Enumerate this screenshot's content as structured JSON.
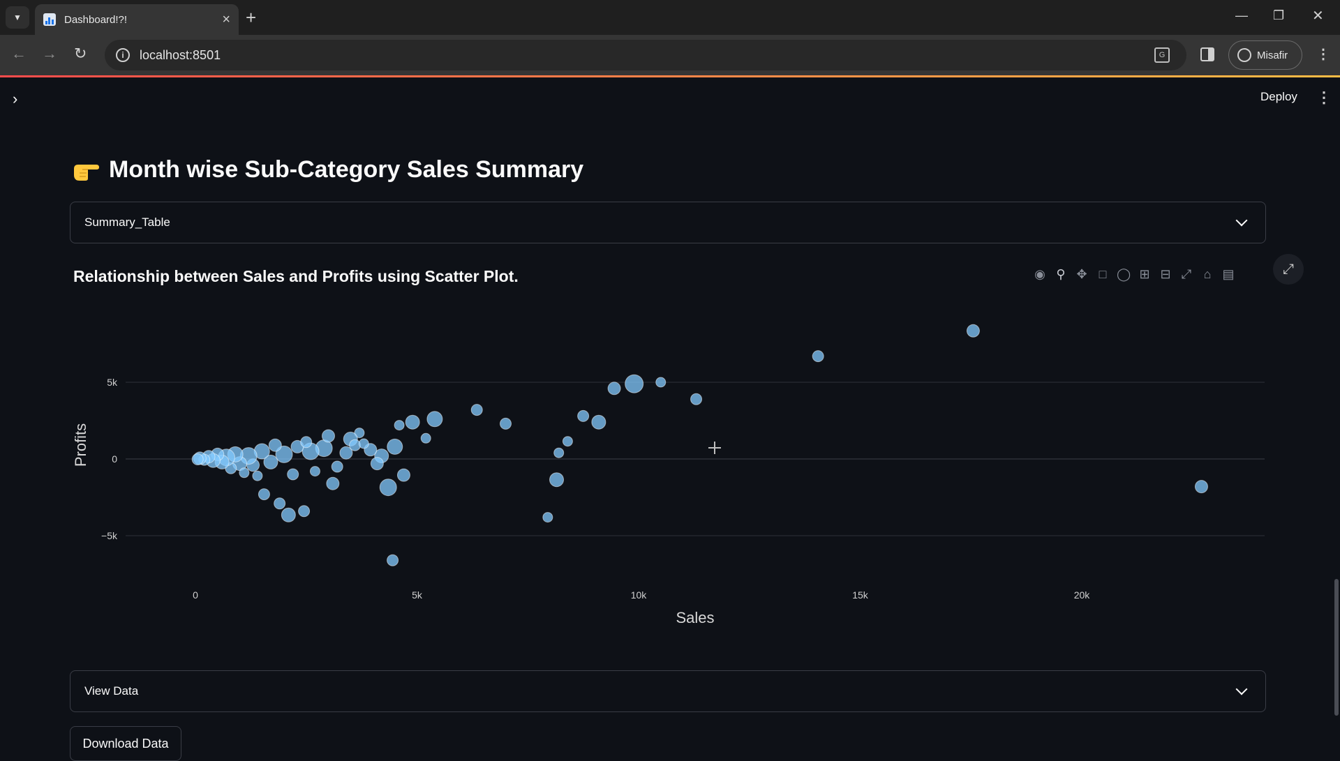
{
  "browser": {
    "tab_title": "Dashboard!?!",
    "url": "localhost:8501",
    "profile_name": "Misafir"
  },
  "app": {
    "deploy_label": "Deploy",
    "page_title": "Month wise Sub-Category Sales Summary",
    "summary_expander_label": "Summary_Table",
    "chart_title": "Relationship between Sales and Profits using Scatter Plot.",
    "view_data_expander_label": "View Data",
    "download_button_label": "Download Data",
    "colors": {
      "background": "#0e1117",
      "marker": "#83c9ff",
      "accent_start": "#ff4b4b",
      "accent_end": "#ffbd45"
    }
  },
  "chart_data": {
    "type": "scatter",
    "xlabel": "Sales",
    "ylabel": "Profits",
    "xlim": [
      -1600,
      24200
    ],
    "ylim": [
      -7600,
      8800
    ],
    "x_ticks": [
      {
        "value": 0,
        "label": "0"
      },
      {
        "value": 5000,
        "label": "5k"
      },
      {
        "value": 10000,
        "label": "10k"
      },
      {
        "value": 15000,
        "label": "15k"
      },
      {
        "value": 20000,
        "label": "20k"
      }
    ],
    "y_ticks": [
      {
        "value": 5000,
        "label": "5k"
      },
      {
        "value": 0,
        "label": "0"
      },
      {
        "value": -5000,
        "label": "−5k"
      }
    ],
    "grid": "horizontal",
    "marker_color": "#83c9ff",
    "points": [
      {
        "x": 17550,
        "y": 8350,
        "s": 9
      },
      {
        "x": 14050,
        "y": 6700,
        "s": 8
      },
      {
        "x": 9900,
        "y": 4900,
        "s": 13
      },
      {
        "x": 9450,
        "y": 4600,
        "s": 9
      },
      {
        "x": 10500,
        "y": 5000,
        "s": 7
      },
      {
        "x": 11300,
        "y": 3900,
        "s": 8
      },
      {
        "x": 22700,
        "y": -1800,
        "s": 9
      },
      {
        "x": 6350,
        "y": 3200,
        "s": 8
      },
      {
        "x": 7000,
        "y": 2300,
        "s": 8
      },
      {
        "x": 8750,
        "y": 2800,
        "s": 8
      },
      {
        "x": 9100,
        "y": 2400,
        "s": 10
      },
      {
        "x": 8400,
        "y": 1150,
        "s": 7
      },
      {
        "x": 8200,
        "y": 400,
        "s": 7
      },
      {
        "x": 8150,
        "y": -1350,
        "s": 10
      },
      {
        "x": 7950,
        "y": -3800,
        "s": 7
      },
      {
        "x": 4450,
        "y": -6600,
        "s": 8
      },
      {
        "x": 5400,
        "y": 2600,
        "s": 11
      },
      {
        "x": 4900,
        "y": 2400,
        "s": 10
      },
      {
        "x": 5200,
        "y": 1350,
        "s": 7
      },
      {
        "x": 4600,
        "y": 2200,
        "s": 7
      },
      {
        "x": 4350,
        "y": -1850,
        "s": 12
      },
      {
        "x": 4700,
        "y": -1050,
        "s": 9
      },
      {
        "x": 3100,
        "y": -1600,
        "s": 9
      },
      {
        "x": 2450,
        "y": -3400,
        "s": 8
      },
      {
        "x": 2100,
        "y": -3650,
        "s": 10
      },
      {
        "x": 1900,
        "y": -2900,
        "s": 8
      },
      {
        "x": 1550,
        "y": -2300,
        "s": 8
      },
      {
        "x": 4200,
        "y": 200,
        "s": 10
      },
      {
        "x": 3700,
        "y": 1700,
        "s": 7
      },
      {
        "x": 3950,
        "y": 600,
        "s": 9
      },
      {
        "x": 4500,
        "y": 800,
        "s": 11
      },
      {
        "x": 4100,
        "y": -300,
        "s": 9
      },
      {
        "x": 2900,
        "y": 700,
        "s": 12
      },
      {
        "x": 3400,
        "y": 400,
        "s": 9
      },
      {
        "x": 3500,
        "y": 1300,
        "s": 10
      },
      {
        "x": 3000,
        "y": 1500,
        "s": 9
      },
      {
        "x": 2600,
        "y": 500,
        "s": 12
      },
      {
        "x": 2300,
        "y": 800,
        "s": 9
      },
      {
        "x": 2000,
        "y": 300,
        "s": 12
      },
      {
        "x": 1800,
        "y": 900,
        "s": 9
      },
      {
        "x": 1700,
        "y": -200,
        "s": 10
      },
      {
        "x": 1500,
        "y": 500,
        "s": 11
      },
      {
        "x": 1300,
        "y": -400,
        "s": 9
      },
      {
        "x": 1200,
        "y": 200,
        "s": 12
      },
      {
        "x": 1000,
        "y": -300,
        "s": 10
      },
      {
        "x": 900,
        "y": 300,
        "s": 11
      },
      {
        "x": 800,
        "y": -600,
        "s": 8
      },
      {
        "x": 700,
        "y": 100,
        "s": 12
      },
      {
        "x": 600,
        "y": -200,
        "s": 10
      },
      {
        "x": 500,
        "y": 300,
        "s": 9
      },
      {
        "x": 400,
        "y": -100,
        "s": 10
      },
      {
        "x": 300,
        "y": 150,
        "s": 9
      },
      {
        "x": 200,
        "y": -50,
        "s": 8
      },
      {
        "x": 100,
        "y": 50,
        "s": 9
      },
      {
        "x": 50,
        "y": -20,
        "s": 8
      },
      {
        "x": 2200,
        "y": -1000,
        "s": 8
      },
      {
        "x": 2700,
        "y": -800,
        "s": 7
      },
      {
        "x": 3200,
        "y": -500,
        "s": 8
      },
      {
        "x": 2500,
        "y": 1100,
        "s": 8
      },
      {
        "x": 1100,
        "y": -900,
        "s": 7
      },
      {
        "x": 1400,
        "y": -1100,
        "s": 7
      },
      {
        "x": 3600,
        "y": 900,
        "s": 8
      },
      {
        "x": 3800,
        "y": 1000,
        "s": 7
      }
    ]
  }
}
